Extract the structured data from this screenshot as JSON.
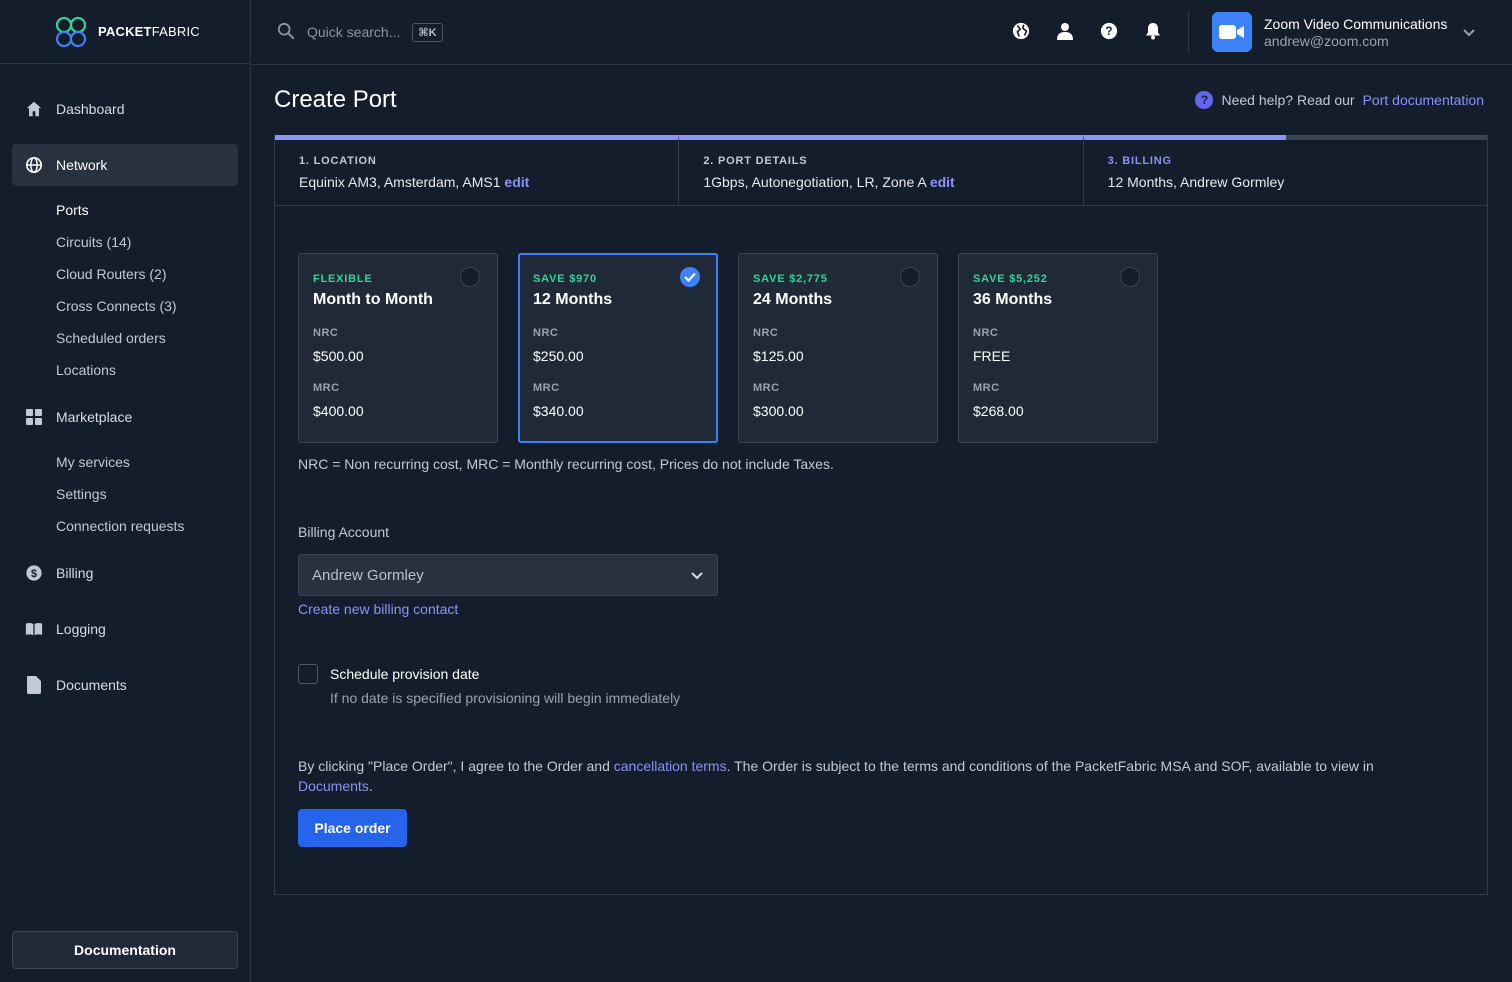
{
  "brand": {
    "name_bold": "PACKET",
    "name_thin": "FABRIC"
  },
  "search": {
    "placeholder": "Quick search...",
    "shortcut": "⌘K"
  },
  "account": {
    "name": "Zoom Video Communications",
    "email": "andrew@zoom.com"
  },
  "sidebar": {
    "dashboard": "Dashboard",
    "network": "Network",
    "network_items": [
      "Ports",
      "Circuits (14)",
      "Cloud Routers (2)",
      "Cross Connects (3)",
      "Scheduled orders",
      "Locations"
    ],
    "marketplace": "Marketplace",
    "marketplace_items": [
      "My services",
      "Settings",
      "Connection requests"
    ],
    "billing": "Billing",
    "logging": "Logging",
    "documents": "Documents",
    "documentation_button": "Documentation"
  },
  "page": {
    "title": "Create Port",
    "help_prefix": "Need help? Read our",
    "help_link": "Port documentation"
  },
  "steps": [
    {
      "label": "1. LOCATION",
      "value": "Equinix AM3, Amsterdam, AMS1",
      "edit": "edit"
    },
    {
      "label": "2. PORT DETAILS",
      "value": "1Gbps, Autonegotiation, LR, Zone A",
      "edit": "edit"
    },
    {
      "label": "3. BILLING",
      "value": "12 Months, Andrew Gormley",
      "edit": ""
    }
  ],
  "plans": [
    {
      "tag": "FLEXIBLE",
      "name": "Month to Month",
      "nrc_label": "NRC",
      "nrc": "$500.00",
      "mrc_label": "MRC",
      "mrc": "$400.00",
      "selected": false
    },
    {
      "tag": "SAVE $970",
      "name": "12 Months",
      "nrc_label": "NRC",
      "nrc": "$250.00",
      "mrc_label": "MRC",
      "mrc": "$340.00",
      "selected": true
    },
    {
      "tag": "SAVE $2,775",
      "name": "24 Months",
      "nrc_label": "NRC",
      "nrc": "$125.00",
      "mrc_label": "MRC",
      "mrc": "$300.00",
      "selected": false
    },
    {
      "tag": "SAVE $5,252",
      "name": "36 Months",
      "nrc_label": "NRC",
      "nrc": "FREE",
      "mrc_label": "MRC",
      "mrc": "$268.00",
      "selected": false
    }
  ],
  "pricing_note": "NRC = Non recurring cost, MRC = Monthly recurring cost, Prices do not include Taxes.",
  "billing": {
    "label": "Billing Account",
    "selected": "Andrew Gormley",
    "create_link": "Create new billing contact"
  },
  "schedule": {
    "label": "Schedule provision date",
    "help": "If no date is specified provisioning will begin immediately",
    "checked": false
  },
  "terms": {
    "part1": "By clicking \"Place Order\", I agree to the Order and ",
    "link1": "cancellation terms",
    "part2": ". The Order is subject to the terms and conditions of the PacketFabric MSA and SOF, available to view in ",
    "link2": "Documents",
    "part3": "."
  },
  "place_order": "Place order",
  "colors": {
    "accent": "#8b93f7",
    "primary": "#2563eb",
    "save_green": "#34d399",
    "bg": "#141d2b"
  }
}
